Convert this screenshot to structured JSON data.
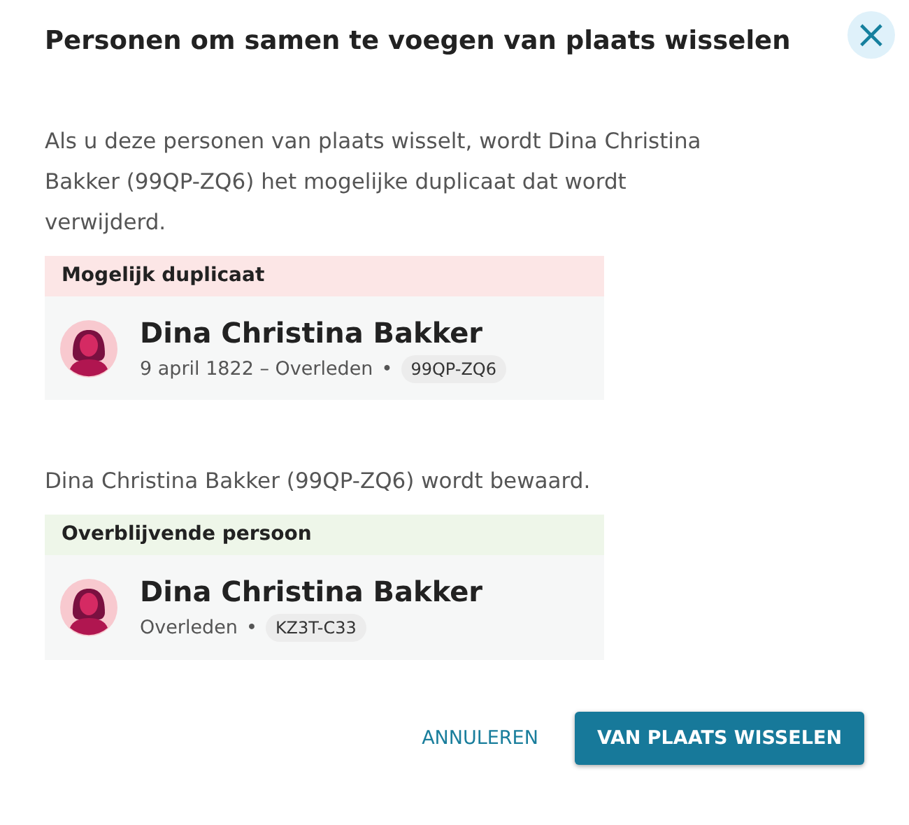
{
  "dialog": {
    "title": "Personen om samen te voegen van plaats wisselen",
    "close": "×"
  },
  "sections": [
    {
      "intro": "Als u deze personen van plaats wisselt, wordt Dina Christina Bakker (99QP-ZQ6) het mogelijke duplicaat dat wordt verwijderd.",
      "kind": "duplicate",
      "header": "Mogelijk duplicaat",
      "person": {
        "name": "Dina Christina Bakker",
        "details": "9 april 1822 – Overleden",
        "bullet": "•",
        "id": "99QP-ZQ6"
      }
    },
    {
      "intro": "Dina Christina Bakker (99QP-ZQ6) wordt bewaard.",
      "kind": "surviving",
      "header": "Overblijvende persoon",
      "person": {
        "name": "Dina Christina Bakker",
        "details": "Overleden",
        "bullet": "•",
        "id": "KZ3T-C33"
      }
    }
  ],
  "buttons": [
    {
      "label": "ANNULEREN",
      "kind": "text"
    },
    {
      "label": "VAN PLAATS WISSELEN",
      "kind": "primary"
    }
  ]
}
